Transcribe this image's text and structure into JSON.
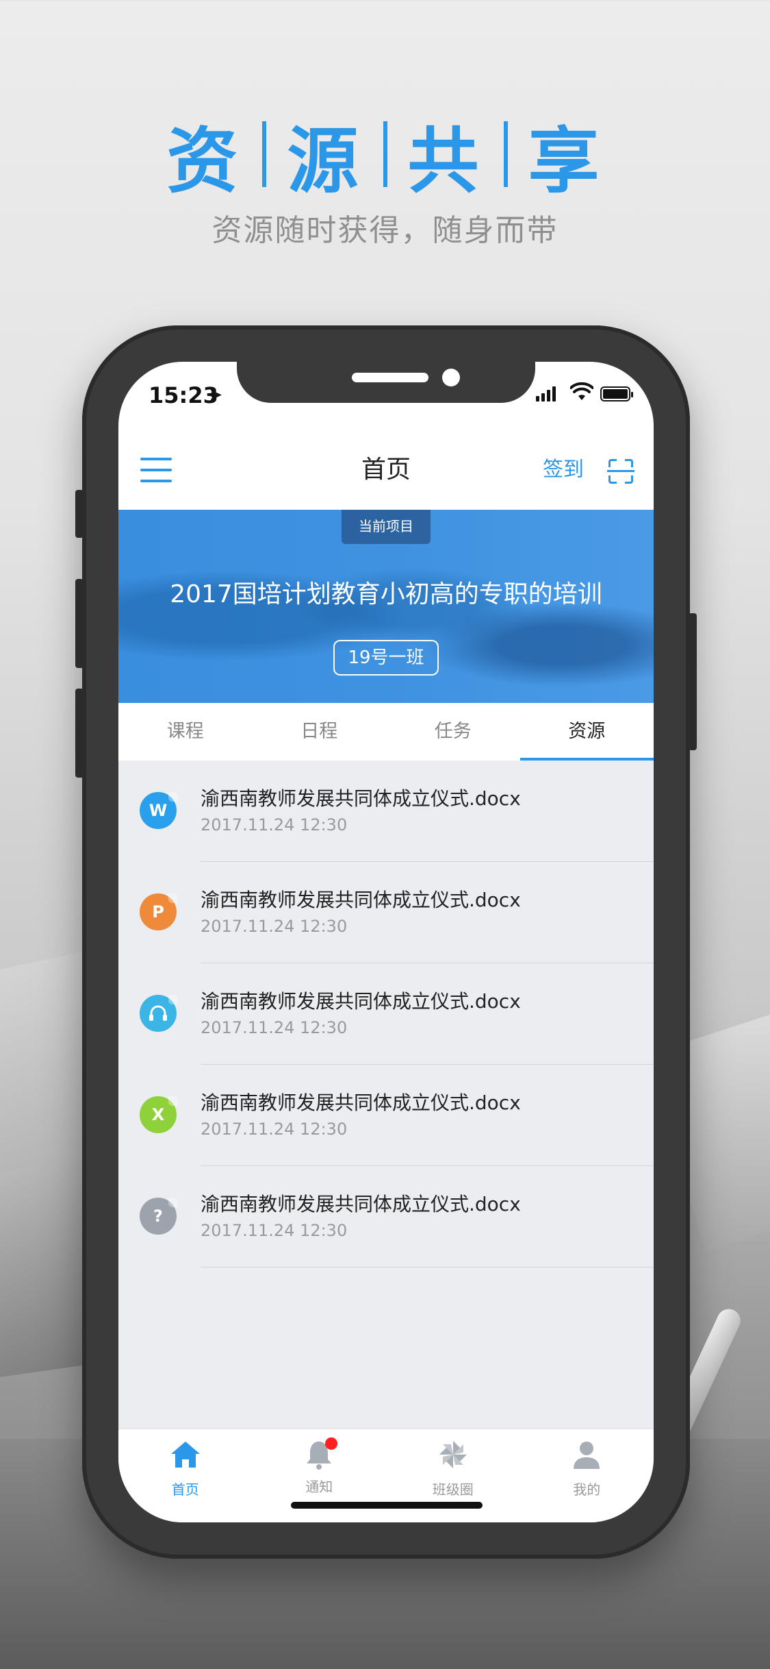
{
  "headline": {
    "chars": [
      "资",
      "源",
      "共",
      "享"
    ],
    "subtitle": "资源随时获得，随身而带"
  },
  "status_bar": {
    "time": "15:23"
  },
  "nav": {
    "title": "首页",
    "sign_in": "签到"
  },
  "banner": {
    "tag": "当前项目",
    "title": "2017国培计划教育小初高的专职的培训",
    "class_name": "19号一班"
  },
  "tabs": [
    {
      "label": "课程"
    },
    {
      "label": "日程"
    },
    {
      "label": "任务"
    },
    {
      "label": "资源",
      "active": true
    }
  ],
  "files": [
    {
      "icon_letter": "W",
      "icon": "word-file-icon",
      "color": "#2aa0ec",
      "name": "渝西南教师发展共同体成立仪式.docx",
      "time": "2017.11.24 12:30"
    },
    {
      "icon_letter": "P",
      "icon": "ppt-file-icon",
      "color": "#ef8a3b",
      "name": "渝西南教师发展共同体成立仪式.docx",
      "time": "2017.11.24 12:30"
    },
    {
      "icon_letter": "",
      "icon": "audio-file-icon",
      "color": "#3ab5e6",
      "name": "渝西南教师发展共同体成立仪式.docx",
      "time": "2017.11.24 12:30"
    },
    {
      "icon_letter": "X",
      "icon": "excel-file-icon",
      "color": "#8fd13a",
      "name": "渝西南教师发展共同体成立仪式.docx",
      "time": "2017.11.24 12:30"
    },
    {
      "icon_letter": "?",
      "icon": "unknown-file-icon",
      "color": "#9ca3ad",
      "name": "渝西南教师发展共同体成立仪式.docx",
      "time": "2017.11.24 12:30"
    }
  ],
  "bottom_nav": [
    {
      "label": "首页",
      "icon": "home-icon",
      "active": true
    },
    {
      "label": "通知",
      "icon": "bell-icon",
      "badge": true
    },
    {
      "label": "班级圈",
      "icon": "pinwheel-icon"
    },
    {
      "label": "我的",
      "icon": "person-icon"
    }
  ],
  "colors": {
    "accent": "#2a97e8",
    "badge": "#ff2020"
  }
}
